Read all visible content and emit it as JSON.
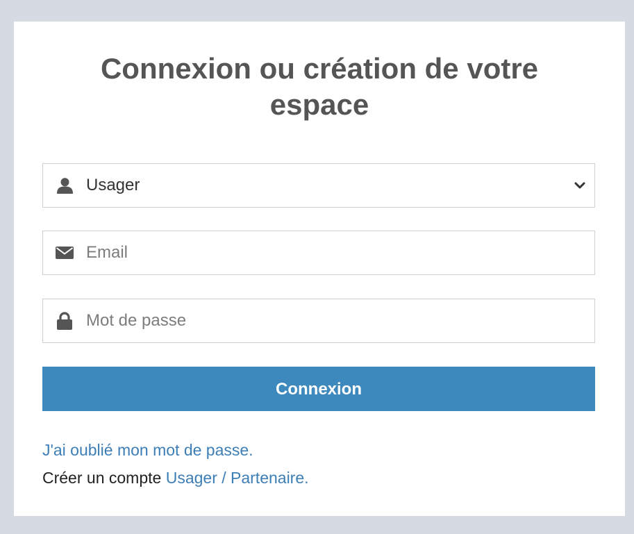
{
  "form": {
    "title_line1": "Connexion ou création de votre",
    "title_line2": "espace",
    "account_type": {
      "selected": "Usager",
      "icon": "user-icon",
      "options": [
        "Usager"
      ]
    },
    "email": {
      "placeholder": "Email",
      "value": "",
      "icon": "envelope-icon"
    },
    "password": {
      "placeholder": "Mot de passe",
      "value": "",
      "icon": "lock-icon"
    },
    "submit_label": "Connexion",
    "forgot_password": "J'ai oublié mon mot de passe.",
    "create_account_prefix": "Créer un compte ",
    "create_account_link": "Usager / Partenaire",
    "create_account_suffix": "."
  },
  "colors": {
    "background": "#d6dae2",
    "panel": "#ffffff",
    "title": "#555555",
    "button": "#3d88bd",
    "link": "#3d7eb6"
  }
}
